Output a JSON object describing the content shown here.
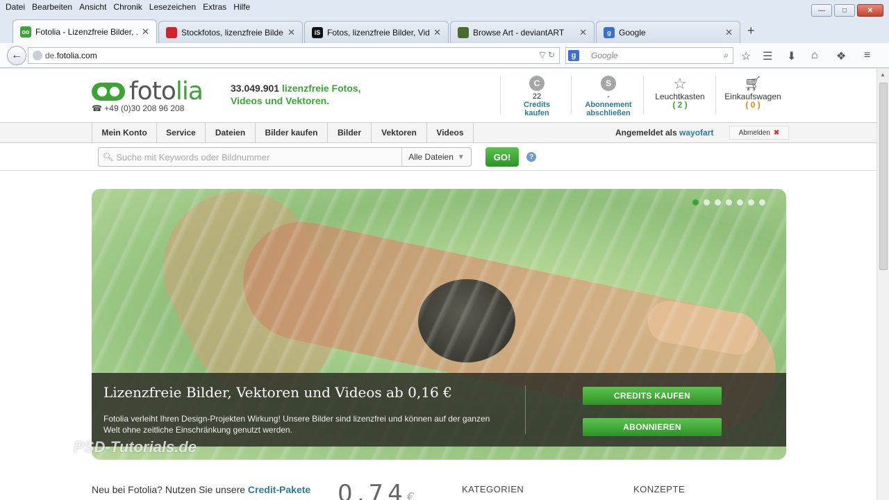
{
  "browser": {
    "menu": [
      "Datei",
      "Bearbeiten",
      "Ansicht",
      "Chronik",
      "Lesezeichen",
      "Extras",
      "Hilfe"
    ],
    "tabs": [
      {
        "label": "Fotolia - Lizenzfreie Bilder, ...",
        "favicon_color": "#3aa535",
        "favicon_text": "oo"
      },
      {
        "label": "Stockfotos, lizenzfreie Bilde...",
        "favicon_color": "#d2232a",
        "favicon_text": ""
      },
      {
        "label": "Fotos, lizenzfreie Bilder, Vid...",
        "favicon_color": "#111111",
        "favicon_text": "iS"
      },
      {
        "label": "Browse Art - deviantART",
        "favicon_color": "#4b6b2c",
        "favicon_text": ""
      },
      {
        "label": "Google",
        "favicon_color": "#3b6fd3",
        "favicon_text": "g"
      }
    ],
    "url_prefix": "de.",
    "url_domain": "fotolia.com",
    "search_placeholder": "Google",
    "search_engine_icon": "g"
  },
  "header": {
    "logo_main": "foto",
    "logo_accent": "lia",
    "phone": "+49 (0)30 208 96 208",
    "tagline_number": "33.049.901",
    "tagline_line1": "lizenzfreie Fotos,",
    "tagline_line2": "Videos und Vektoren.",
    "credits": {
      "icon": "C",
      "count": "22",
      "line1": "Credits",
      "line2": "kaufen"
    },
    "subscription": {
      "icon": "S",
      "count": "-",
      "line1": "Abonnement",
      "line2": "abschließen"
    },
    "lightbox": {
      "label": "Leuchtkasten",
      "count": "( 2 )"
    },
    "cart": {
      "label": "Einkaufswagen",
      "count": "( 0 )"
    }
  },
  "nav": {
    "items": [
      "Mein Konto",
      "Service",
      "Dateien",
      "Bilder kaufen",
      "Bilder",
      "Vektoren",
      "Videos"
    ],
    "logged_prefix": "Angemeldet als",
    "username": "wayofart",
    "logout": "Abmelden"
  },
  "search": {
    "placeholder": "Suche mit Keywords oder Bildnummer",
    "filter": "Alle Dateien",
    "go": "GO!",
    "help": "?"
  },
  "hero": {
    "title": "Lizenzfreie Bilder, Vektoren und Videos ab 0,16 €",
    "description": "Fotolia verleiht Ihren Design-Projekten Wirkung! Unsere Bilder sind lizenzfrei und können auf der ganzen Welt ohne zeitliche Einschränkung genutzt werden.",
    "btn_credits": "CREDITS KAUFEN",
    "btn_subscribe": "ABONNIEREN",
    "slide_count": 7,
    "active_slide": 1
  },
  "watermark": "PSD-Tutorials.de",
  "bottom": {
    "intro": "Neu bei Fotolia? Nutzen Sie unsere",
    "link": "Credit-Pakete",
    "price": "0,74",
    "currency": "€",
    "categories": "KATEGORIEN",
    "concepts": "KONZEPTE"
  },
  "colors": {
    "brand_green": "#3aa535",
    "link_blue": "#2b7a9e"
  }
}
